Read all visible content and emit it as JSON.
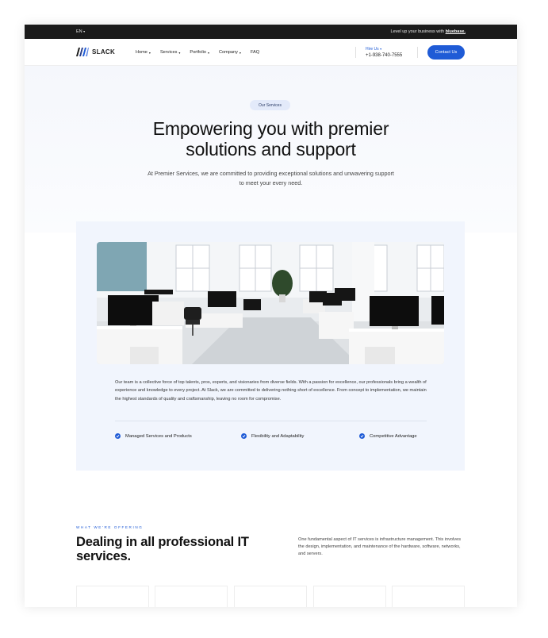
{
  "topbar": {
    "language": "EN",
    "promo_text": "Level up your business with",
    "promo_link": "bluebase."
  },
  "header": {
    "logo_text": "SLACK",
    "nav": [
      {
        "label": "Home",
        "has_dropdown": true
      },
      {
        "label": "Services",
        "has_dropdown": true
      },
      {
        "label": "Portfolio",
        "has_dropdown": true
      },
      {
        "label": "Company",
        "has_dropdown": true
      },
      {
        "label": "FAQ",
        "has_dropdown": false
      }
    ],
    "hire_label": "Hire Us",
    "hire_phone": "+1-938-740-7555",
    "contact_button": "Contact Us"
  },
  "hero": {
    "pill": "Our Services",
    "title_line1": "Empowering you with premier",
    "title_line2": "solutions and support",
    "subtitle": "At Premier Services, we are committed to providing exceptional solutions and unwavering support to meet your every need."
  },
  "card": {
    "description": "Our team is a collective force of top talents, pros, experts, and visionaries from diverse fields. With a passion for excellence, our professionals bring a wealth of experience and knowledge to every project. At Slack, we are committed to delivering nothing short of excellence. From concept to implementation, we maintain the highest standards of quality and craftsmanship, leaving no room for compromise.",
    "features": [
      "Managed Services and Products",
      "Flexibility and Adaptability",
      "Competitive Advantage"
    ]
  },
  "offering": {
    "eyebrow": "WHAT WE'RE OFFERING",
    "title": "Dealing in all professional IT services.",
    "text": "One fundamental aspect of IT services is infrastructure management. This involves the design, implementation, and maintenance of the hardware, software, networks, and servers."
  },
  "colors": {
    "accent": "#1f5bd6",
    "topbar_bg": "#1b1b1b",
    "card_bg": "#f1f5fd"
  }
}
